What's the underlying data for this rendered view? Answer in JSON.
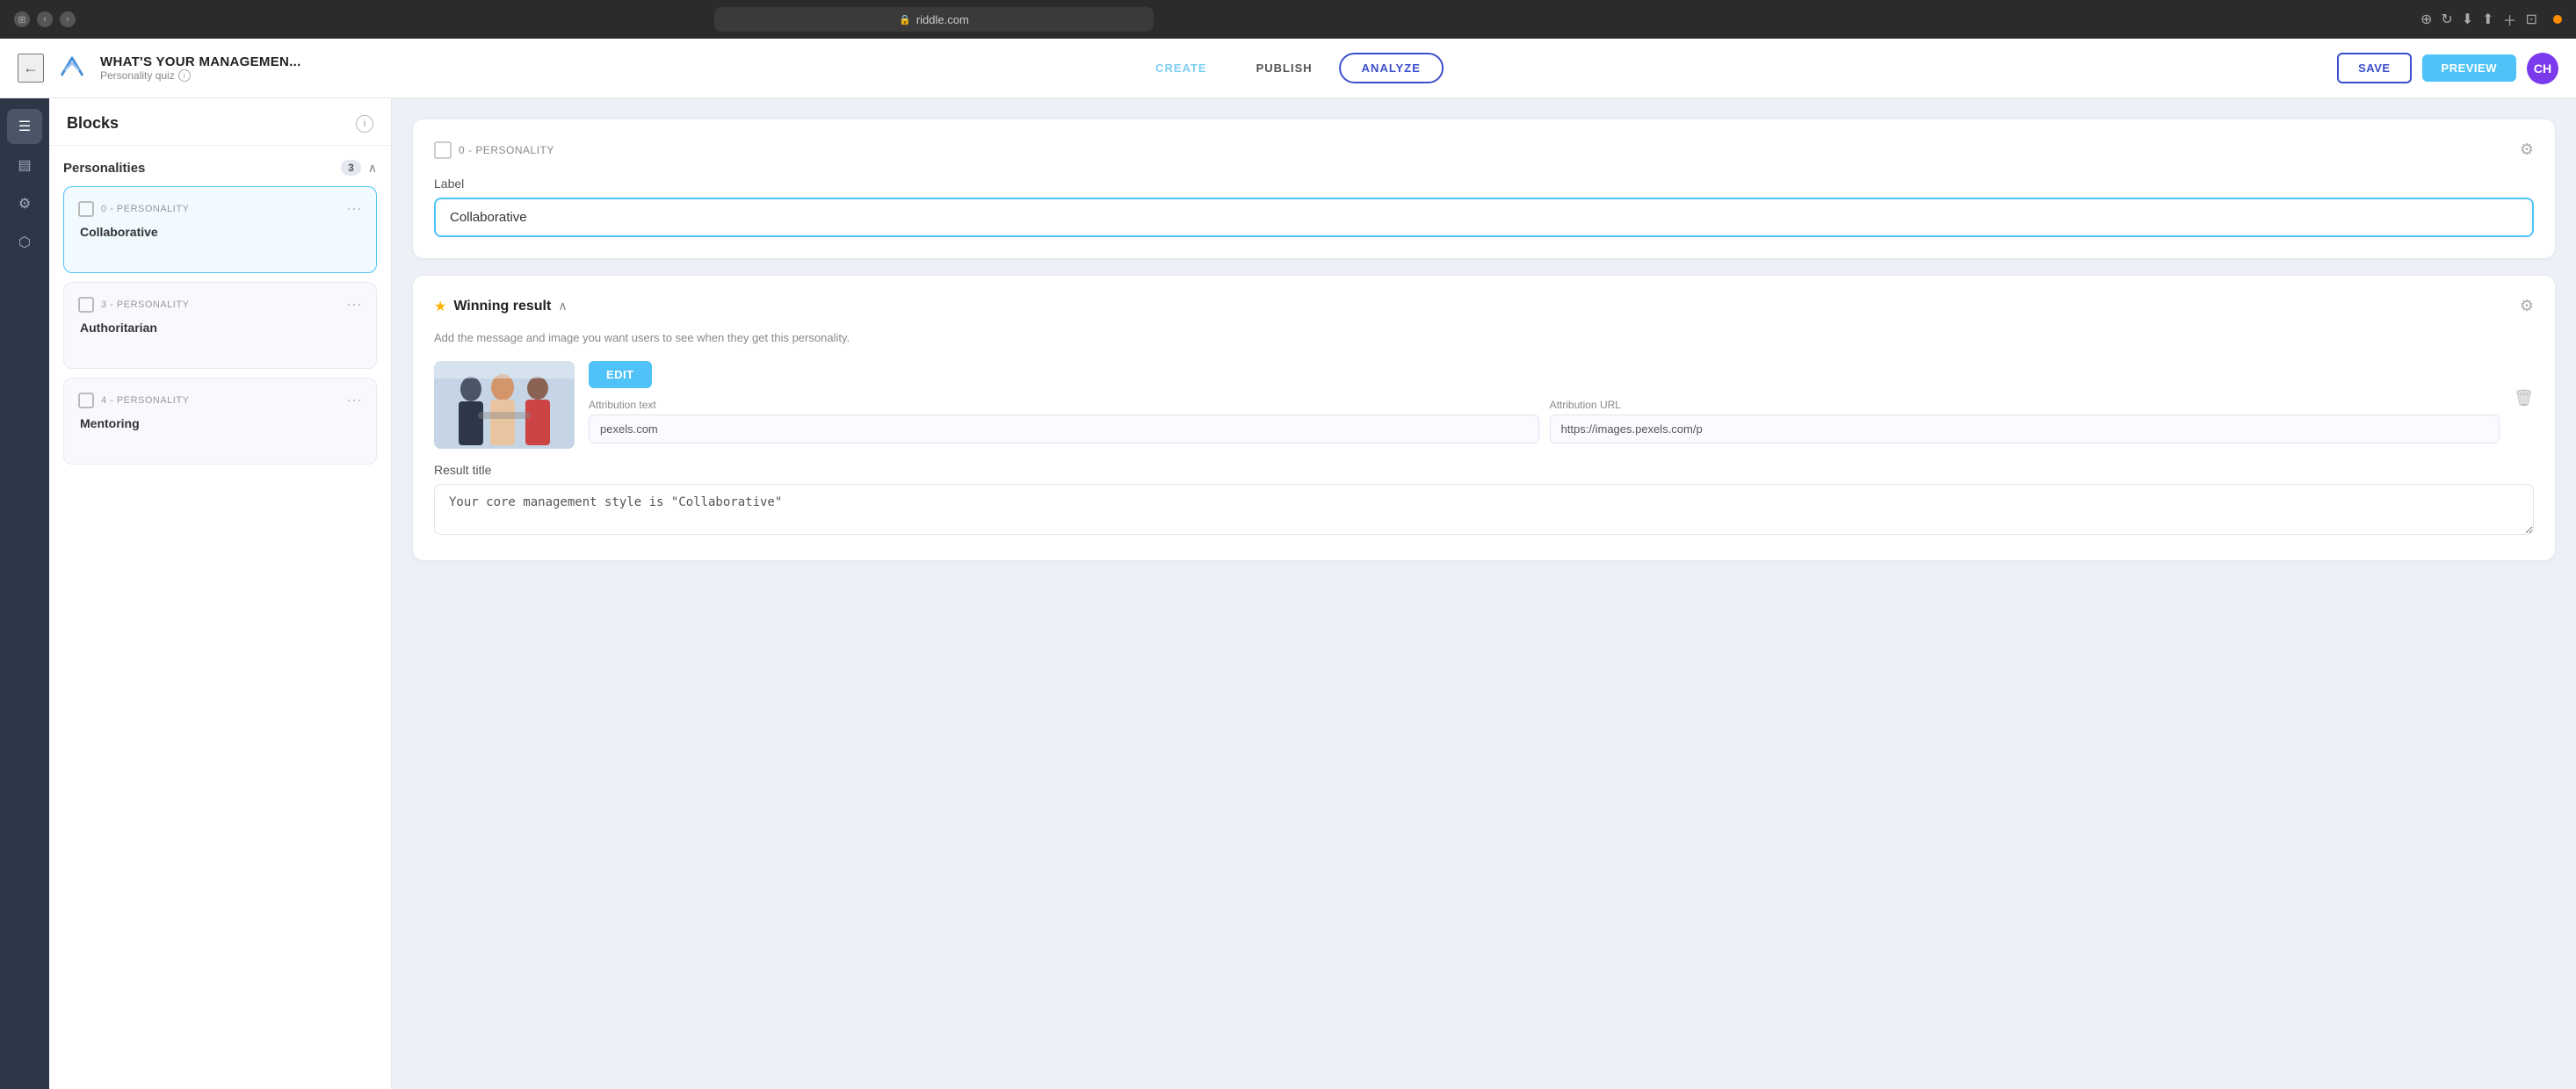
{
  "browser": {
    "url": "riddle.com",
    "lock_icon": "🔒"
  },
  "header": {
    "project_title": "WHAT'S YOUR MANAGEMEN...",
    "project_subtitle": "Personality quiz",
    "nav": {
      "create_label": "CREATE",
      "publish_label": "PUBLISH",
      "analyze_label": "ANALYZE"
    },
    "save_label": "SAVE",
    "preview_label": "PREVIEW",
    "avatar_initials": "CH"
  },
  "sidebar_icons": {
    "blocks_icon": "☰",
    "layers_icon": "▤",
    "settings_icon": "⚙",
    "analytics_icon": "⬡"
  },
  "blocks_panel": {
    "title": "Blocks",
    "personalities_section": {
      "label": "Personalities",
      "count": 3,
      "cards": [
        {
          "type_label": "0 - PERSONALITY",
          "name": "Collaborative",
          "selected": true
        },
        {
          "type_label": "3 - PERSONALITY",
          "name": "Authoritarian",
          "selected": false
        },
        {
          "type_label": "4 - PERSONALITY",
          "name": "Mentoring",
          "selected": false
        }
      ]
    }
  },
  "main": {
    "personality_block": {
      "tag": "0 - PERSONALITY",
      "label_field": "Label",
      "label_value": "Collaborative"
    },
    "winning_result": {
      "title": "Winning result",
      "description": "Add the message and image you want users to see when they get this personality.",
      "edit_label": "EDIT",
      "attribution_text_label": "Attribution text",
      "attribution_text_value": "pexels.com",
      "attribution_url_label": "Attribution URL",
      "attribution_url_value": "https://images.pexels.com/p",
      "result_title_label": "Result title",
      "result_title_value": "Your core management style is \"Collaborative\""
    }
  }
}
